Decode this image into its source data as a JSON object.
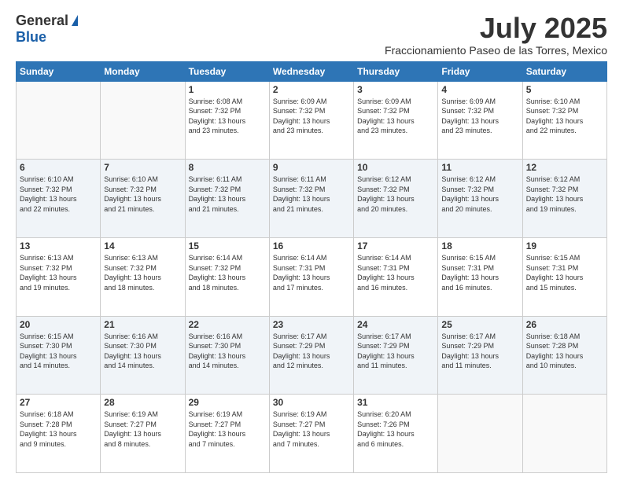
{
  "logo": {
    "general": "General",
    "blue": "Blue"
  },
  "title": {
    "month": "July 2025",
    "location": "Fraccionamiento Paseo de las Torres, Mexico"
  },
  "headers": [
    "Sunday",
    "Monday",
    "Tuesday",
    "Wednesday",
    "Thursday",
    "Friday",
    "Saturday"
  ],
  "weeks": [
    [
      {
        "day": "",
        "info": ""
      },
      {
        "day": "",
        "info": ""
      },
      {
        "day": "1",
        "info": "Sunrise: 6:08 AM\nSunset: 7:32 PM\nDaylight: 13 hours\nand 23 minutes."
      },
      {
        "day": "2",
        "info": "Sunrise: 6:09 AM\nSunset: 7:32 PM\nDaylight: 13 hours\nand 23 minutes."
      },
      {
        "day": "3",
        "info": "Sunrise: 6:09 AM\nSunset: 7:32 PM\nDaylight: 13 hours\nand 23 minutes."
      },
      {
        "day": "4",
        "info": "Sunrise: 6:09 AM\nSunset: 7:32 PM\nDaylight: 13 hours\nand 23 minutes."
      },
      {
        "day": "5",
        "info": "Sunrise: 6:10 AM\nSunset: 7:32 PM\nDaylight: 13 hours\nand 22 minutes."
      }
    ],
    [
      {
        "day": "6",
        "info": "Sunrise: 6:10 AM\nSunset: 7:32 PM\nDaylight: 13 hours\nand 22 minutes."
      },
      {
        "day": "7",
        "info": "Sunrise: 6:10 AM\nSunset: 7:32 PM\nDaylight: 13 hours\nand 21 minutes."
      },
      {
        "day": "8",
        "info": "Sunrise: 6:11 AM\nSunset: 7:32 PM\nDaylight: 13 hours\nand 21 minutes."
      },
      {
        "day": "9",
        "info": "Sunrise: 6:11 AM\nSunset: 7:32 PM\nDaylight: 13 hours\nand 21 minutes."
      },
      {
        "day": "10",
        "info": "Sunrise: 6:12 AM\nSunset: 7:32 PM\nDaylight: 13 hours\nand 20 minutes."
      },
      {
        "day": "11",
        "info": "Sunrise: 6:12 AM\nSunset: 7:32 PM\nDaylight: 13 hours\nand 20 minutes."
      },
      {
        "day": "12",
        "info": "Sunrise: 6:12 AM\nSunset: 7:32 PM\nDaylight: 13 hours\nand 19 minutes."
      }
    ],
    [
      {
        "day": "13",
        "info": "Sunrise: 6:13 AM\nSunset: 7:32 PM\nDaylight: 13 hours\nand 19 minutes."
      },
      {
        "day": "14",
        "info": "Sunrise: 6:13 AM\nSunset: 7:32 PM\nDaylight: 13 hours\nand 18 minutes."
      },
      {
        "day": "15",
        "info": "Sunrise: 6:14 AM\nSunset: 7:32 PM\nDaylight: 13 hours\nand 18 minutes."
      },
      {
        "day": "16",
        "info": "Sunrise: 6:14 AM\nSunset: 7:31 PM\nDaylight: 13 hours\nand 17 minutes."
      },
      {
        "day": "17",
        "info": "Sunrise: 6:14 AM\nSunset: 7:31 PM\nDaylight: 13 hours\nand 16 minutes."
      },
      {
        "day": "18",
        "info": "Sunrise: 6:15 AM\nSunset: 7:31 PM\nDaylight: 13 hours\nand 16 minutes."
      },
      {
        "day": "19",
        "info": "Sunrise: 6:15 AM\nSunset: 7:31 PM\nDaylight: 13 hours\nand 15 minutes."
      }
    ],
    [
      {
        "day": "20",
        "info": "Sunrise: 6:15 AM\nSunset: 7:30 PM\nDaylight: 13 hours\nand 14 minutes."
      },
      {
        "day": "21",
        "info": "Sunrise: 6:16 AM\nSunset: 7:30 PM\nDaylight: 13 hours\nand 14 minutes."
      },
      {
        "day": "22",
        "info": "Sunrise: 6:16 AM\nSunset: 7:30 PM\nDaylight: 13 hours\nand 14 minutes."
      },
      {
        "day": "23",
        "info": "Sunrise: 6:17 AM\nSunset: 7:29 PM\nDaylight: 13 hours\nand 12 minutes."
      },
      {
        "day": "24",
        "info": "Sunrise: 6:17 AM\nSunset: 7:29 PM\nDaylight: 13 hours\nand 11 minutes."
      },
      {
        "day": "25",
        "info": "Sunrise: 6:17 AM\nSunset: 7:29 PM\nDaylight: 13 hours\nand 11 minutes."
      },
      {
        "day": "26",
        "info": "Sunrise: 6:18 AM\nSunset: 7:28 PM\nDaylight: 13 hours\nand 10 minutes."
      }
    ],
    [
      {
        "day": "27",
        "info": "Sunrise: 6:18 AM\nSunset: 7:28 PM\nDaylight: 13 hours\nand 9 minutes."
      },
      {
        "day": "28",
        "info": "Sunrise: 6:19 AM\nSunset: 7:27 PM\nDaylight: 13 hours\nand 8 minutes."
      },
      {
        "day": "29",
        "info": "Sunrise: 6:19 AM\nSunset: 7:27 PM\nDaylight: 13 hours\nand 7 minutes."
      },
      {
        "day": "30",
        "info": "Sunrise: 6:19 AM\nSunset: 7:27 PM\nDaylight: 13 hours\nand 7 minutes."
      },
      {
        "day": "31",
        "info": "Sunrise: 6:20 AM\nSunset: 7:26 PM\nDaylight: 13 hours\nand 6 minutes."
      },
      {
        "day": "",
        "info": ""
      },
      {
        "day": "",
        "info": ""
      }
    ]
  ]
}
